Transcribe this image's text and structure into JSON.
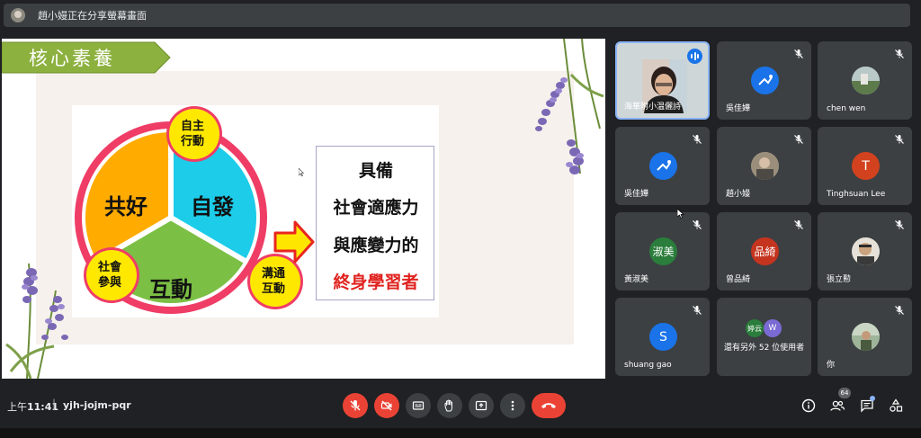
{
  "share_bar": {
    "text": "趙小嫚正在分享螢幕畫面"
  },
  "slide": {
    "title": "核心素養",
    "diagram": {
      "center_left": "共好",
      "center_right": "自發",
      "center_bottom": "互動",
      "circle_top": [
        "自主",
        "行動"
      ],
      "circle_left": [
        "社會",
        "參與"
      ],
      "circle_right": [
        "溝通",
        "互動"
      ]
    },
    "textbox": {
      "line1": "具備",
      "line2": "社會適應力",
      "line3": "與應變力的",
      "line4": "終身學習者"
    },
    "colors": {
      "title_green": "#8db13f",
      "segment_orange": "#ffab00",
      "segment_cyan": "#1ccce8",
      "segment_green": "#7bbf44",
      "ring_pink": "#ef3d66",
      "circle_yellow": "#ffe800",
      "arrow_yellow": "#ffe600",
      "arrow_red": "#e8251f"
    }
  },
  "participants": [
    {
      "name": "海華附小温儷詩",
      "type": "video",
      "speaking": true
    },
    {
      "name": "吳佳嬅",
      "type": "avatar",
      "avatar_icon": "bird-avatar"
    },
    {
      "name": "chen wen",
      "type": "photo"
    },
    {
      "name": "吳佳嬅",
      "type": "avatar",
      "avatar_icon": "bird-avatar"
    },
    {
      "name": "趙小嫚",
      "type": "photo"
    },
    {
      "name": "Tinghsuan Lee",
      "type": "letter",
      "letter": "T"
    },
    {
      "name": "黃淑美",
      "type": "letter",
      "letter": "淑美"
    },
    {
      "name": "曾品綺",
      "type": "letter",
      "letter": "品綺"
    },
    {
      "name": "張立懃",
      "type": "photo"
    },
    {
      "name": "shuang gao",
      "type": "letter",
      "letter": "S"
    },
    {
      "name": "還有另外 52 位使用者",
      "type": "group",
      "letters": [
        "婷云",
        "W"
      ]
    },
    {
      "name": "你",
      "type": "photo"
    }
  ],
  "bottom_bar": {
    "time_prefix": "上午",
    "time": "11:41",
    "separator": "|",
    "meeting_code": "yjh-jojm-pqr",
    "participant_count": "64",
    "controls": [
      "mic-off-icon",
      "camera-off-icon",
      "captions-icon",
      "raise-hand-icon",
      "present-icon",
      "more-options-icon",
      "hang-up-icon"
    ],
    "right_controls": [
      "info-icon",
      "people-icon",
      "chat-icon",
      "activities-icon"
    ]
  }
}
